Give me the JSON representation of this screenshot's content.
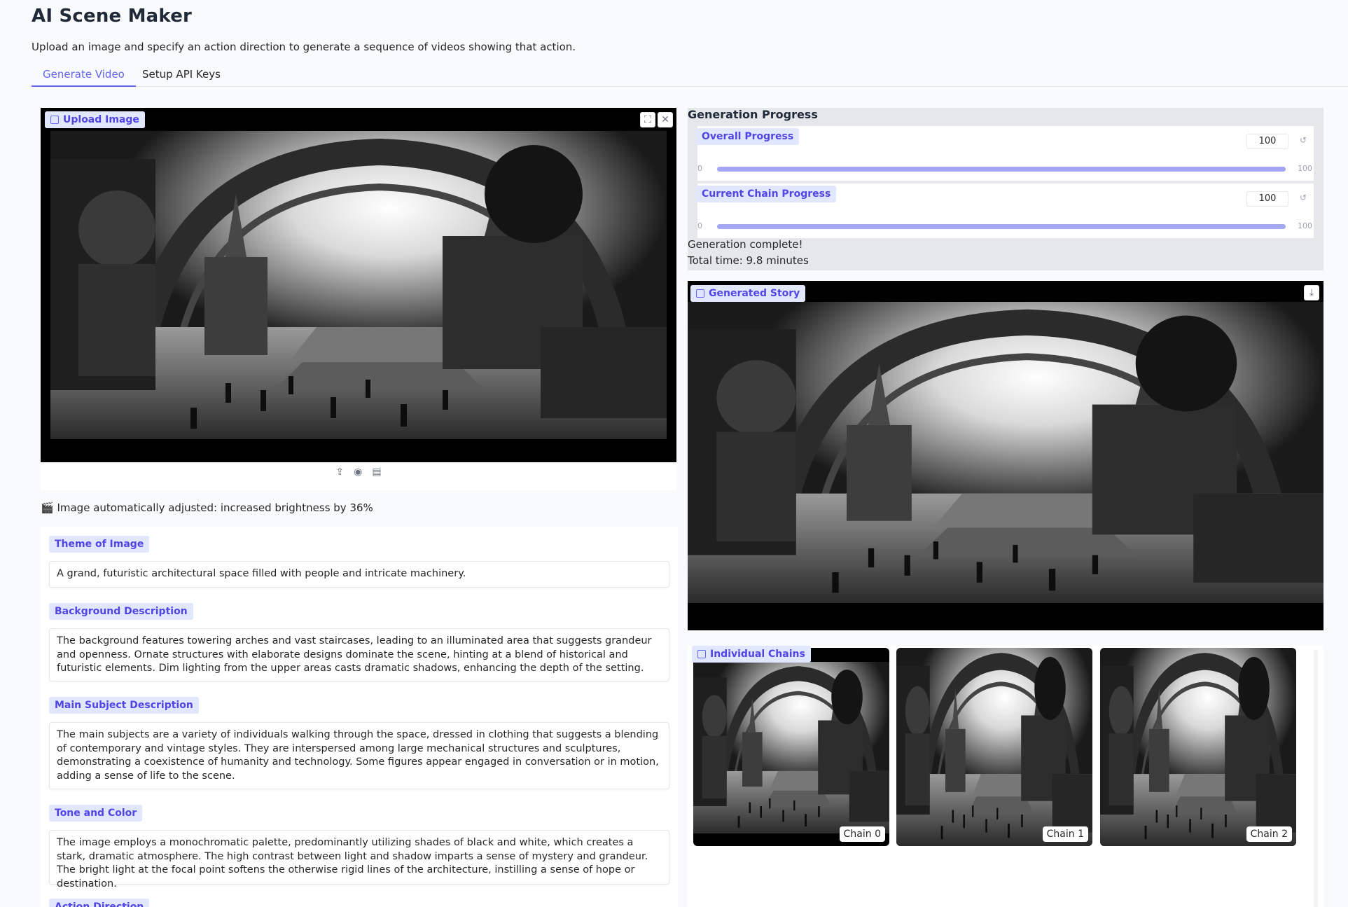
{
  "app": {
    "title": "AI Scene Maker",
    "description": "Upload an image and specify an action direction to generate a sequence of videos showing that action."
  },
  "tabs": [
    {
      "label": "Generate Video",
      "active": true
    },
    {
      "label": "Setup API Keys",
      "active": false
    }
  ],
  "upload": {
    "label": "Upload Image",
    "fullscreen_icon": "fullscreen-icon",
    "close_icon": "close-icon",
    "tools": [
      "upload-icon",
      "webcam-icon",
      "clipboard-icon"
    ]
  },
  "adjust_note": "🎬 Image automatically adjusted: increased brightness by 36%",
  "fields": [
    {
      "label": "Theme of Image",
      "value": "A grand, futuristic architectural space filled with people and intricate machinery."
    },
    {
      "label": "Background Description",
      "value": "The background features towering arches and vast staircases, leading to an illuminated area that suggests grandeur and openness. Ornate structures with elaborate designs dominate the scene, hinting at a blend of historical and futuristic elements. Dim lighting from the upper areas casts dramatic shadows, enhancing the depth of the setting."
    },
    {
      "label": "Main Subject Description",
      "value": "The main subjects are a variety of individuals walking through the space, dressed in clothing that suggests a blending of contemporary and vintage styles. They are interspersed among large mechanical structures and sculptures, demonstrating a coexistence of humanity and technology. Some figures appear engaged in conversation or in motion, adding a sense of life to the scene."
    },
    {
      "label": "Tone and Color",
      "value": "The image employs a monochromatic palette, predominantly utilizing shades of black and white, which creates a stark, dramatic atmosphere. The high contrast between light and shadow imparts a sense of mystery and grandeur. The bright light at the focal point softens the otherwise rigid lines of the architecture, instilling a sense of hope or destination."
    },
    {
      "label": "Action Direction",
      "value": ""
    }
  ],
  "progress": {
    "title": "Generation Progress",
    "overall": {
      "label": "Overall Progress",
      "value": "100",
      "min": "0",
      "max": "100",
      "fraction": 1.0
    },
    "chain": {
      "label": "Current Chain Progress",
      "value": "100",
      "min": "0",
      "max": "100",
      "fraction": 1.0
    },
    "status_line1": "Generation complete!",
    "status_line2": "Total time: 9.8 minutes"
  },
  "story": {
    "label": "Generated Story",
    "download_icon": "download-icon"
  },
  "chains": {
    "label": "Individual Chains",
    "items": [
      {
        "label": "Chain 0"
      },
      {
        "label": "Chain 1"
      },
      {
        "label": "Chain 2"
      }
    ]
  },
  "colors": {
    "accent": "#6366f1",
    "chip_bg": "#e0e7ff",
    "progress_fill": "#a5a6f6"
  }
}
